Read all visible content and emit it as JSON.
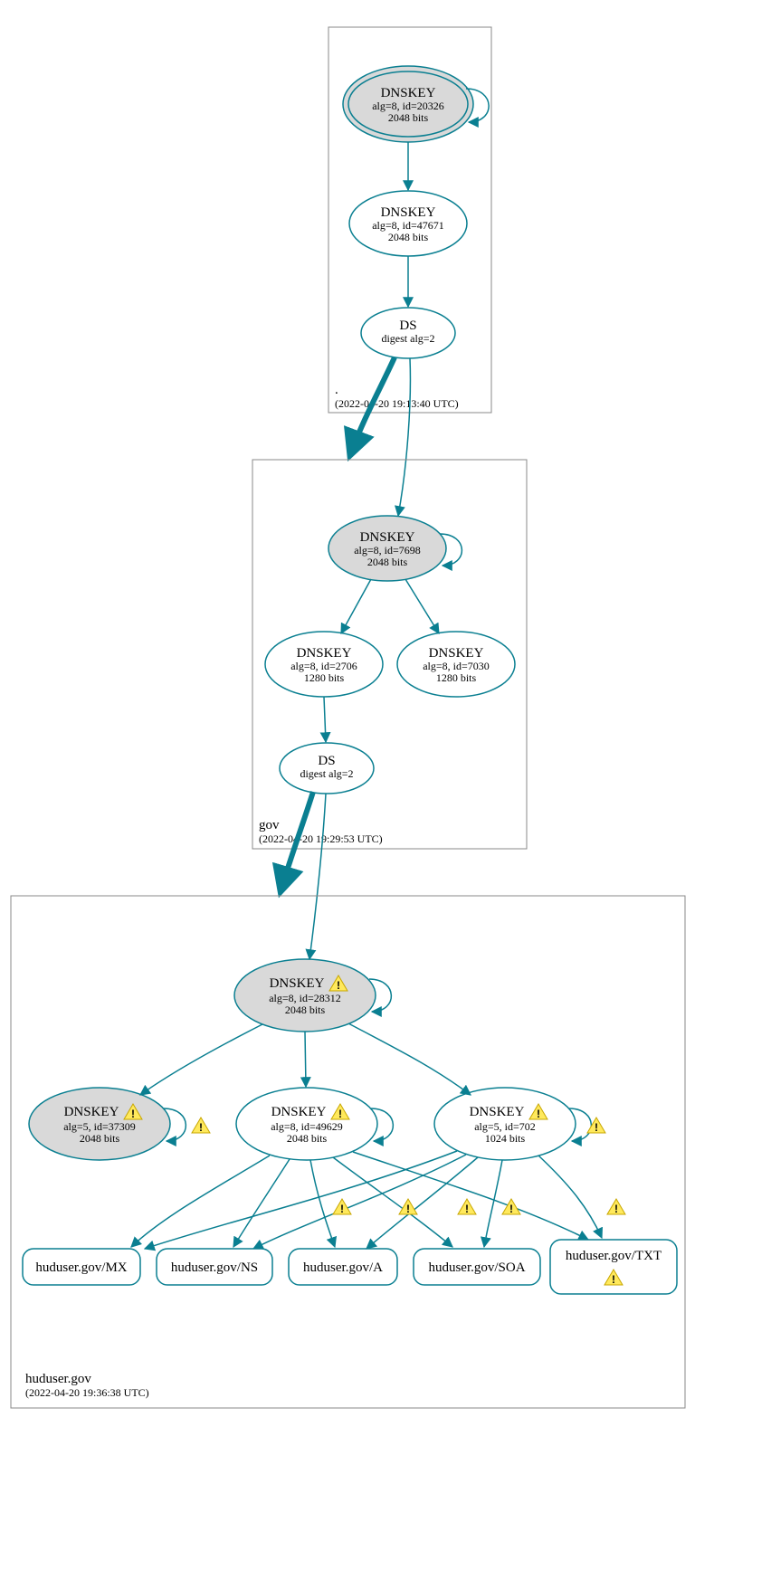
{
  "zones": {
    "root": {
      "label": ".",
      "timestamp": "(2022-04-20 19:13:40 UTC)"
    },
    "gov": {
      "label": "gov",
      "timestamp": "(2022-04-20 19:29:53 UTC)"
    },
    "huduser": {
      "label": "huduser.gov",
      "timestamp": "(2022-04-20 19:36:38 UTC)"
    }
  },
  "nodes": {
    "root_ksk": {
      "title": "DNSKEY",
      "line2": "alg=8, id=20326",
      "line3": "2048 bits"
    },
    "root_zsk": {
      "title": "DNSKEY",
      "line2": "alg=8, id=47671",
      "line3": "2048 bits"
    },
    "root_ds": {
      "title": "DS",
      "line2": "digest alg=2"
    },
    "gov_ksk": {
      "title": "DNSKEY",
      "line2": "alg=8, id=7698",
      "line3": "2048 bits"
    },
    "gov_zsk1": {
      "title": "DNSKEY",
      "line2": "alg=8, id=2706",
      "line3": "1280 bits"
    },
    "gov_zsk2": {
      "title": "DNSKEY",
      "line2": "alg=8, id=7030",
      "line3": "1280 bits"
    },
    "gov_ds": {
      "title": "DS",
      "line2": "digest alg=2"
    },
    "hud_ksk": {
      "title": "DNSKEY",
      "line2": "alg=8, id=28312",
      "line3": "2048 bits"
    },
    "hud_key1": {
      "title": "DNSKEY",
      "line2": "alg=5, id=37309",
      "line3": "2048 bits"
    },
    "hud_key2": {
      "title": "DNSKEY",
      "line2": "alg=8, id=49629",
      "line3": "2048 bits"
    },
    "hud_key3": {
      "title": "DNSKEY",
      "line2": "alg=5, id=702",
      "line3": "1024 bits"
    },
    "rr_mx": {
      "label": "huduser.gov/MX"
    },
    "rr_ns": {
      "label": "huduser.gov/NS"
    },
    "rr_a": {
      "label": "huduser.gov/A"
    },
    "rr_soa": {
      "label": "huduser.gov/SOA"
    },
    "rr_txt": {
      "label": "huduser.gov/TXT"
    }
  }
}
